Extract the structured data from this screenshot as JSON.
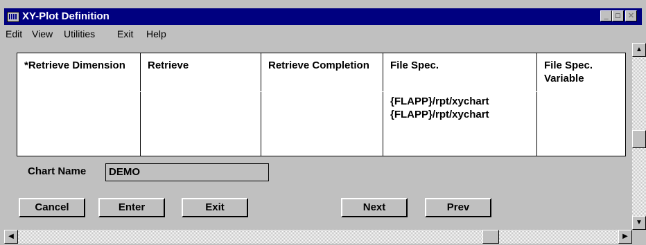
{
  "window": {
    "title": "XY-Plot Definition",
    "minimize_glyph": "_",
    "maximize_glyph": "□",
    "close_glyph": "✕"
  },
  "menu": {
    "items": [
      "Edit",
      "View",
      "Utilities",
      "Exit",
      "Help"
    ]
  },
  "grid": {
    "columns": [
      {
        "header": "*Retrieve Dimension"
      },
      {
        "header": "Retrieve"
      },
      {
        "header": "Retrieve Completion"
      },
      {
        "header": "File Spec."
      },
      {
        "header": "File Spec. Variable"
      }
    ],
    "rows": [
      [
        "",
        "",
        "",
        "{FLAPP}/rpt/xychart",
        ""
      ],
      [
        "",
        "",
        "",
        "{FLAPP}/rpt/xychart",
        ""
      ]
    ]
  },
  "chart_name": {
    "label": "Chart Name",
    "value": "DEMO"
  },
  "buttons": {
    "cancel": "Cancel",
    "enter": "Enter",
    "exit": "Exit",
    "next": "Next",
    "prev": "Prev"
  },
  "scroll": {
    "up": "▲",
    "down": "▼",
    "left": "◀",
    "right": "▶"
  }
}
